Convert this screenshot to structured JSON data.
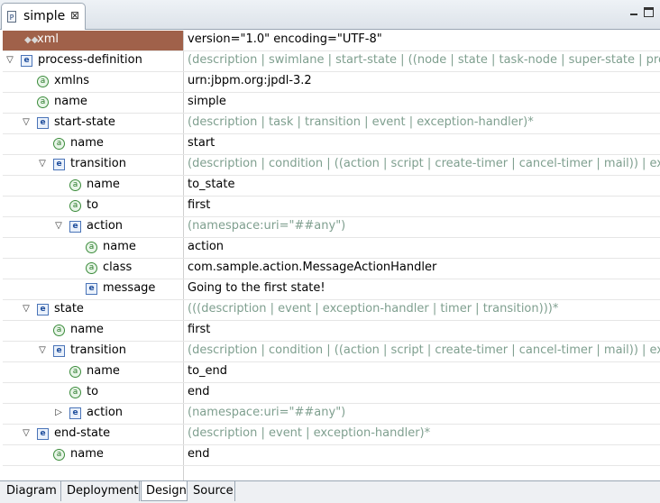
{
  "editor": {
    "tab_title": "simple",
    "tab_icon_glyph": "P"
  },
  "rows": [
    {
      "kind": "pi",
      "indent": 0,
      "twisty": "none",
      "label": "xml",
      "value": "version=\"1.0\" encoding=\"UTF-8\"",
      "hint": false,
      "selected": true
    },
    {
      "kind": "e",
      "indent": 0,
      "twisty": "open",
      "label": "process-definition",
      "value": "(description | swimlane | start-state | ((node | state | task-node | super-state | pro",
      "hint": true
    },
    {
      "kind": "a",
      "indent": 1,
      "twisty": "none",
      "label": "xmlns",
      "value": "urn:jbpm.org:jpdl-3.2",
      "hint": false
    },
    {
      "kind": "a",
      "indent": 1,
      "twisty": "none",
      "label": "name",
      "value": "simple",
      "hint": false
    },
    {
      "kind": "e",
      "indent": 1,
      "twisty": "open",
      "label": "start-state",
      "value": "(description | task | transition | event | exception-handler)*",
      "hint": true
    },
    {
      "kind": "a",
      "indent": 2,
      "twisty": "none",
      "label": "name",
      "value": "start",
      "hint": false
    },
    {
      "kind": "e",
      "indent": 2,
      "twisty": "open",
      "label": "transition",
      "value": "(description | condition | ((action | script | create-timer | cancel-timer | mail)) | ex",
      "hint": true
    },
    {
      "kind": "a",
      "indent": 3,
      "twisty": "none",
      "label": "name",
      "value": "to_state",
      "hint": false
    },
    {
      "kind": "a",
      "indent": 3,
      "twisty": "none",
      "label": "to",
      "value": "first",
      "hint": false
    },
    {
      "kind": "e",
      "indent": 3,
      "twisty": "open",
      "label": "action",
      "value": "(namespace:uri=\"##any\")",
      "hint": true
    },
    {
      "kind": "a",
      "indent": 4,
      "twisty": "none",
      "label": "name",
      "value": "action",
      "hint": false
    },
    {
      "kind": "a",
      "indent": 4,
      "twisty": "none",
      "label": "class",
      "value": "com.sample.action.MessageActionHandler",
      "hint": false
    },
    {
      "kind": "e",
      "indent": 4,
      "twisty": "none",
      "label": "message",
      "value": "Going to the first state!",
      "hint": false
    },
    {
      "kind": "e",
      "indent": 1,
      "twisty": "open",
      "label": "state",
      "value": "(((description | event | exception-handler | timer | transition)))*",
      "hint": true
    },
    {
      "kind": "a",
      "indent": 2,
      "twisty": "none",
      "label": "name",
      "value": "first",
      "hint": false
    },
    {
      "kind": "e",
      "indent": 2,
      "twisty": "open",
      "label": "transition",
      "value": "(description | condition | ((action | script | create-timer | cancel-timer | mail)) | ex",
      "hint": true
    },
    {
      "kind": "a",
      "indent": 3,
      "twisty": "none",
      "label": "name",
      "value": "to_end",
      "hint": false
    },
    {
      "kind": "a",
      "indent": 3,
      "twisty": "none",
      "label": "to",
      "value": "end",
      "hint": false
    },
    {
      "kind": "e",
      "indent": 3,
      "twisty": "closed",
      "label": "action",
      "value": "(namespace:uri=\"##any\")",
      "hint": true
    },
    {
      "kind": "e",
      "indent": 1,
      "twisty": "open",
      "label": "end-state",
      "value": "(description | event | exception-handler)*",
      "hint": true
    },
    {
      "kind": "a",
      "indent": 2,
      "twisty": "none",
      "label": "name",
      "value": "end",
      "hint": false
    }
  ],
  "bottom_tabs": [
    {
      "label": "Diagram",
      "active": false
    },
    {
      "label": "Deployment",
      "active": false
    },
    {
      "label": "Design",
      "active": true
    },
    {
      "label": "Source",
      "active": false
    }
  ],
  "icons": {
    "element": "element-icon",
    "attribute": "attribute-icon",
    "processing_instruction": "processing-instruction-icon",
    "expanded": "expanded-twisty-icon",
    "collapsed": "collapsed-twisty-icon"
  },
  "colors": {
    "selection": "#a0614a",
    "hint_text": "#7f9f8f"
  }
}
